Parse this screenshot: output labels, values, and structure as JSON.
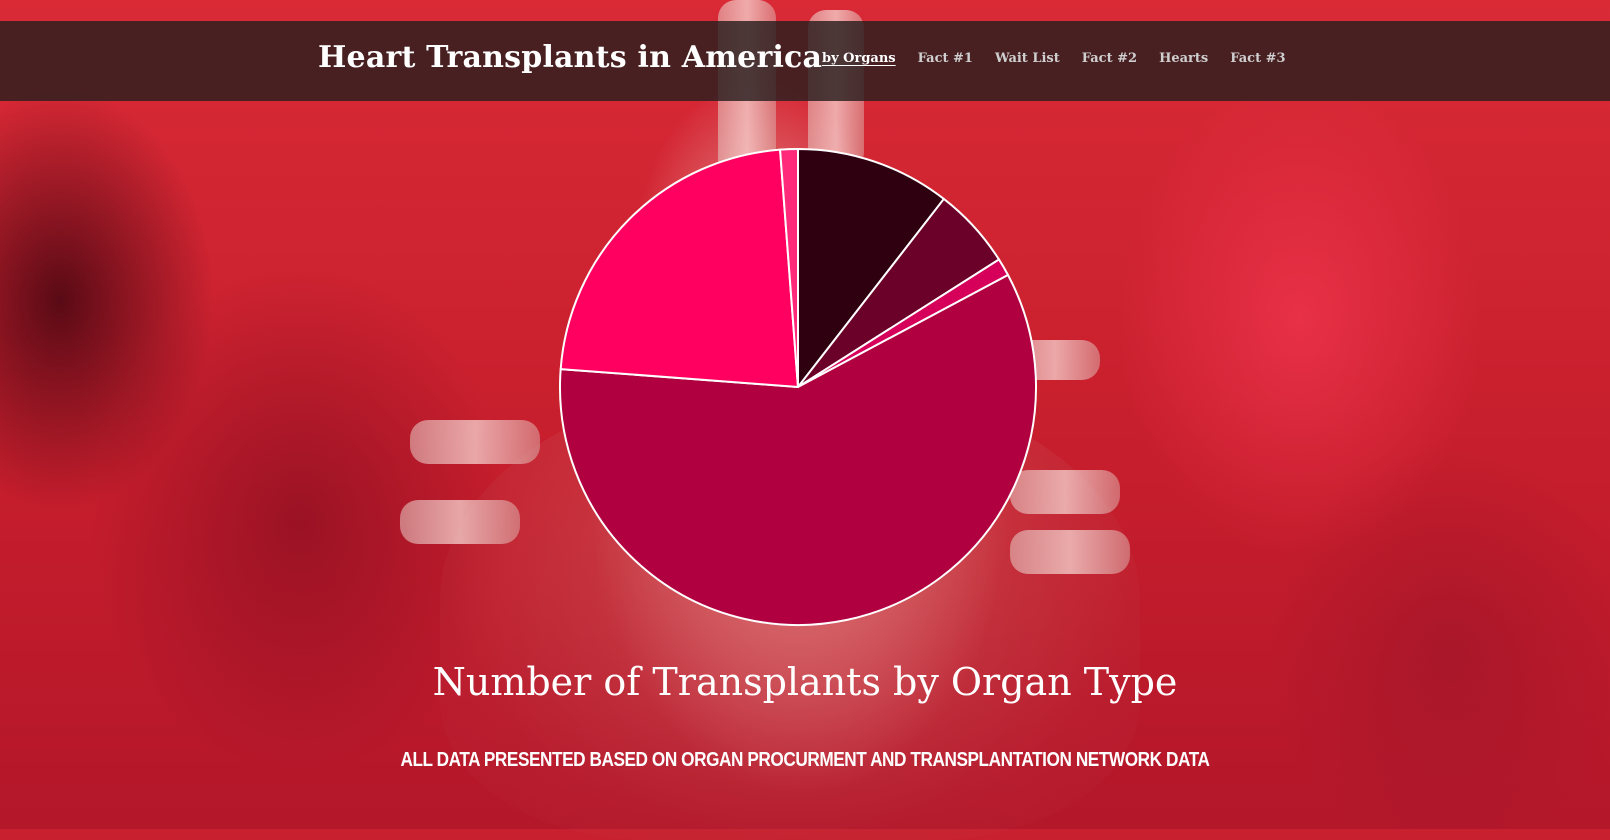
{
  "header": {
    "title": "Heart Transplants in America"
  },
  "nav": {
    "items": [
      {
        "label": "by Organs",
        "active": true
      },
      {
        "label": "Fact #1",
        "active": false
      },
      {
        "label": "Wait List",
        "active": false
      },
      {
        "label": "Fact #2",
        "active": false
      },
      {
        "label": "Hearts",
        "active": false
      },
      {
        "label": "Fact #3",
        "active": false
      }
    ]
  },
  "background": {
    "image": "anatomical-heart-photo",
    "dominant_color": "#c8202e"
  },
  "chart_data": {
    "type": "pie",
    "title": "Number of Transplants by Organ Type",
    "subtitle": "ALL DATA PRESENTED BASED ON ORGAN PROCURMENT AND TRANSPLANTATION NETWORK DATA",
    "slice_border_color": "#ffffff",
    "slices": [
      {
        "value": 10.5,
        "color": "#2e0010"
      },
      {
        "value": 5.5,
        "color": "#6b0028"
      },
      {
        "value": 1.2,
        "color": "#d6005a"
      },
      {
        "value": 59.0,
        "color": "#b0003f"
      },
      {
        "value": 22.6,
        "color": "#ff0061"
      },
      {
        "value": 1.2,
        "color": "#ff2a7a"
      }
    ]
  }
}
